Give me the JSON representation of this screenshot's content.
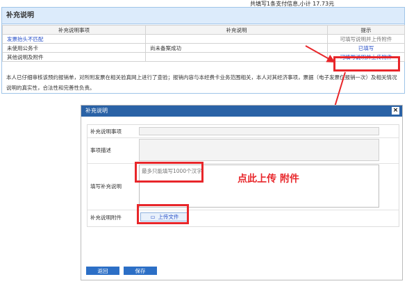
{
  "top_text": "共填写1条支付信息,小计 17.73元",
  "panel": {
    "title": "补充说明",
    "headers": [
      "补充说明事项",
      "补充说明",
      "提示"
    ],
    "rows": [
      {
        "item": "发票抬头不匹配",
        "desc": "",
        "tip": "可填写说明并上传附件"
      },
      {
        "item": "未使用公务卡",
        "desc": "尚未备案成功",
        "tip": "已填写"
      },
      {
        "item": "其他说明及附件",
        "desc": "",
        "tip": "可填写说明并上传附件"
      }
    ],
    "statement": "本人已仔细审核该预约报销单，对所附发票在相关验真网上进行了查验；报销内容与本经费卡业务范围相关，本人对其经济事项，票据（电子发票仅报销一次）及相关情况说明的真实性，合法性和完善性负责。"
  },
  "dialog": {
    "title": "补充说明",
    "close": "×",
    "fields": {
      "item_label": "补充说明事项",
      "desc_label": "事项描述",
      "fill_label": "填写补充说明",
      "fill_placeholder": "最多只能填写1000个汉字",
      "attach_label": "补充说明附件",
      "upload_label": "上传文件"
    },
    "buttons": {
      "back": "返回",
      "save": "保存"
    }
  },
  "annotation": "点此上传 附件",
  "colors": {
    "accent": "#2c6fc6",
    "header": "#2a62a6",
    "highlight": "#e8262a"
  }
}
